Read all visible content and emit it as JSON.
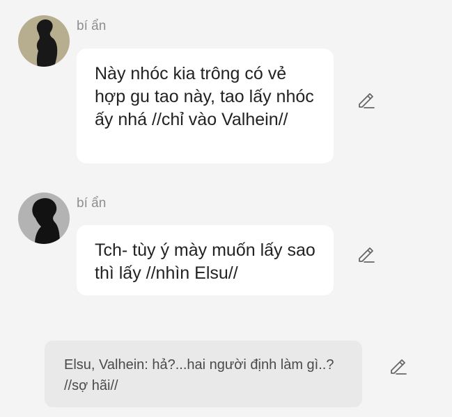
{
  "messages": [
    {
      "sender": "bí ẩn",
      "text": "Này nhóc kia trông có vẻ hợp gu tao này, tao lấy nhóc ấy nhá //chỉ vào Valhein//",
      "edit_icon": "pencil-icon"
    },
    {
      "sender": "bí ẩn",
      "text": "Tch- tùy ý mày muốn lấy sao thì lấy //nhìn Elsu//",
      "edit_icon": "pencil-icon"
    }
  ],
  "narration": {
    "text": "Elsu, Valhein: hả?...hai người định làm gì..? //sợ hãi//",
    "edit_icon": "pencil-icon"
  },
  "colors": {
    "background": "#f4f4f4",
    "bubble": "#ffffff",
    "narration_bubble": "#e9e9e9",
    "sender_text": "#8e8e8e",
    "message_text": "#222222"
  }
}
